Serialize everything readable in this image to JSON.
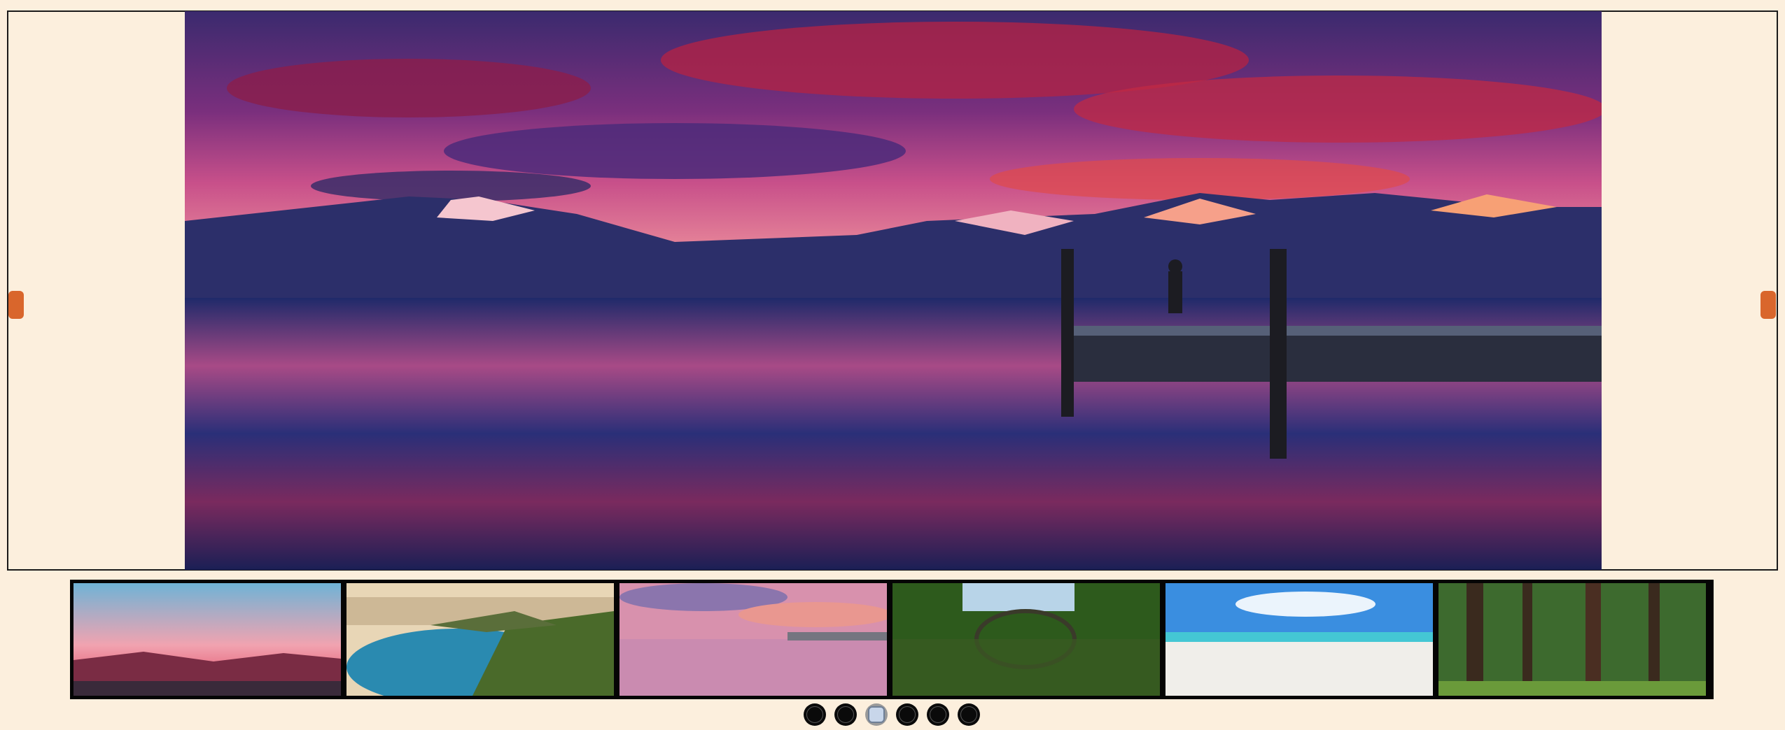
{
  "slideshow": {
    "prev_icon": "chevron-left-icon",
    "next_icon": "chevron-right-icon",
    "accent_color": "#d9662c",
    "background_color": "#fcefdd",
    "current_slide": 3,
    "total_slides": 6,
    "main_image": "sunset-lake-dock-mountains",
    "thumbnails": [
      "pink-sky-hills",
      "coastal-cliffs-bay",
      "sunset-lake-dock",
      "stone-arch-bridge-forest",
      "white-sand-beach",
      "pine-forest"
    ]
  }
}
